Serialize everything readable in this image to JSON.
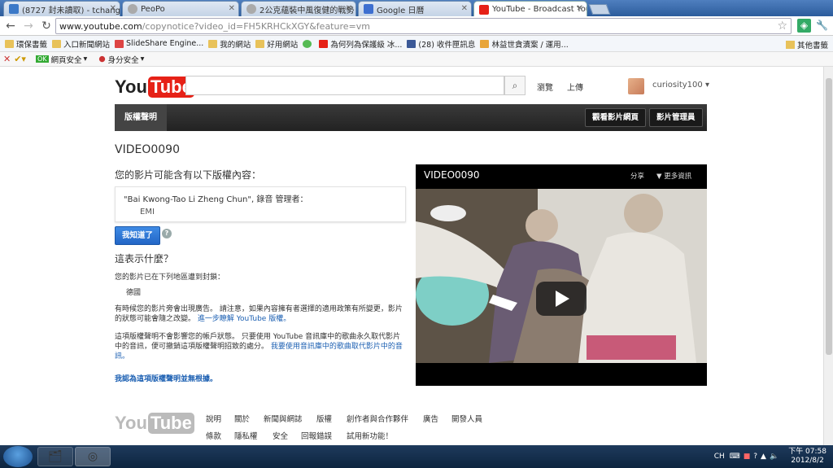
{
  "tabs": [
    {
      "label": "(8727 封未讀取) - tchang",
      "color": "#3b79c8"
    },
    {
      "label": "PeoPo",
      "color": "#888888"
    },
    {
      "label": "2公克蘊裝中風復健的戰勢",
      "color": "#888888"
    },
    {
      "label": "Google 日曆",
      "color": "#3d6fd0"
    },
    {
      "label": "YouTube - Broadcast You",
      "color": "#e62117"
    }
  ],
  "address": {
    "host": "www.youtube.com",
    "path": "/copynotice?video_id=FH5KRHCkXGY&feature=vm"
  },
  "bookmarks": [
    "環保書籤",
    "入口新聞網站",
    "SlideShare Engine...",
    "我的網站",
    "好用網站",
    "",
    "為何列為保護級 冰...",
    "(28) 收件匣訊息",
    "林益世貪瀆案 / 運用..."
  ],
  "bookmarks_right": "其他書籤",
  "pluginbar": {
    "item1": "網頁安全",
    "item2": "身分安全"
  },
  "yt": {
    "logo_you": "You",
    "logo_tube": "Tube",
    "browse": "瀏覽",
    "upload": "上傳",
    "username": "curiosity100"
  },
  "navbar": {
    "current": "版權聲明",
    "btn_watch": "觀看影片網頁",
    "btn_manager": "影片管理員"
  },
  "content": {
    "video_title": "VIDEO0090",
    "heading": "您的影片可能含有以下版權內容：",
    "claim_text": "\"Bai Kwong-Tao Li Zheng Chun\", 錄音 管理者：",
    "claim_owner": "EMI",
    "ack_button": "我知道了",
    "help_icon": "?",
    "what_heading": "這表示什麼？",
    "blocked_line": "您的影片已在下列地區遭到封鎖：",
    "country": "德國",
    "para1": "有時候您的影片旁會出現廣告。 請注意，如果內容擁有者選擇的適用政策有所變更，影片的狀態可能會隨之改變。",
    "para1_link": "進一步瞭解 YouTube 版權。",
    "para2": "這項版權聲明不會影響您的帳戶狀態。 只要使用 YouTube 音訊庫中的歌曲永久取代影片中的音訊，便可撤銷這項版權聲明招致的處分。",
    "para2_link": "我要使用音訊庫中的歌曲取代影片中的音訊。",
    "dispute": "我認為這項版權聲明並無根據。"
  },
  "player": {
    "title": "VIDEO0090",
    "share": "分享",
    "more": "更多資訊"
  },
  "footer": {
    "row1": [
      "說明",
      "關於",
      "新聞與網誌",
      "版權",
      "創作者與合作夥伴",
      "廣告",
      "開發人員"
    ],
    "row2": [
      "條款",
      "隱私權",
      "安全",
      "回報錯誤",
      "試用新功能！"
    ]
  },
  "taskbar": {
    "lang": "CH",
    "time": "下午 07:58",
    "date": "2012/8/2"
  }
}
